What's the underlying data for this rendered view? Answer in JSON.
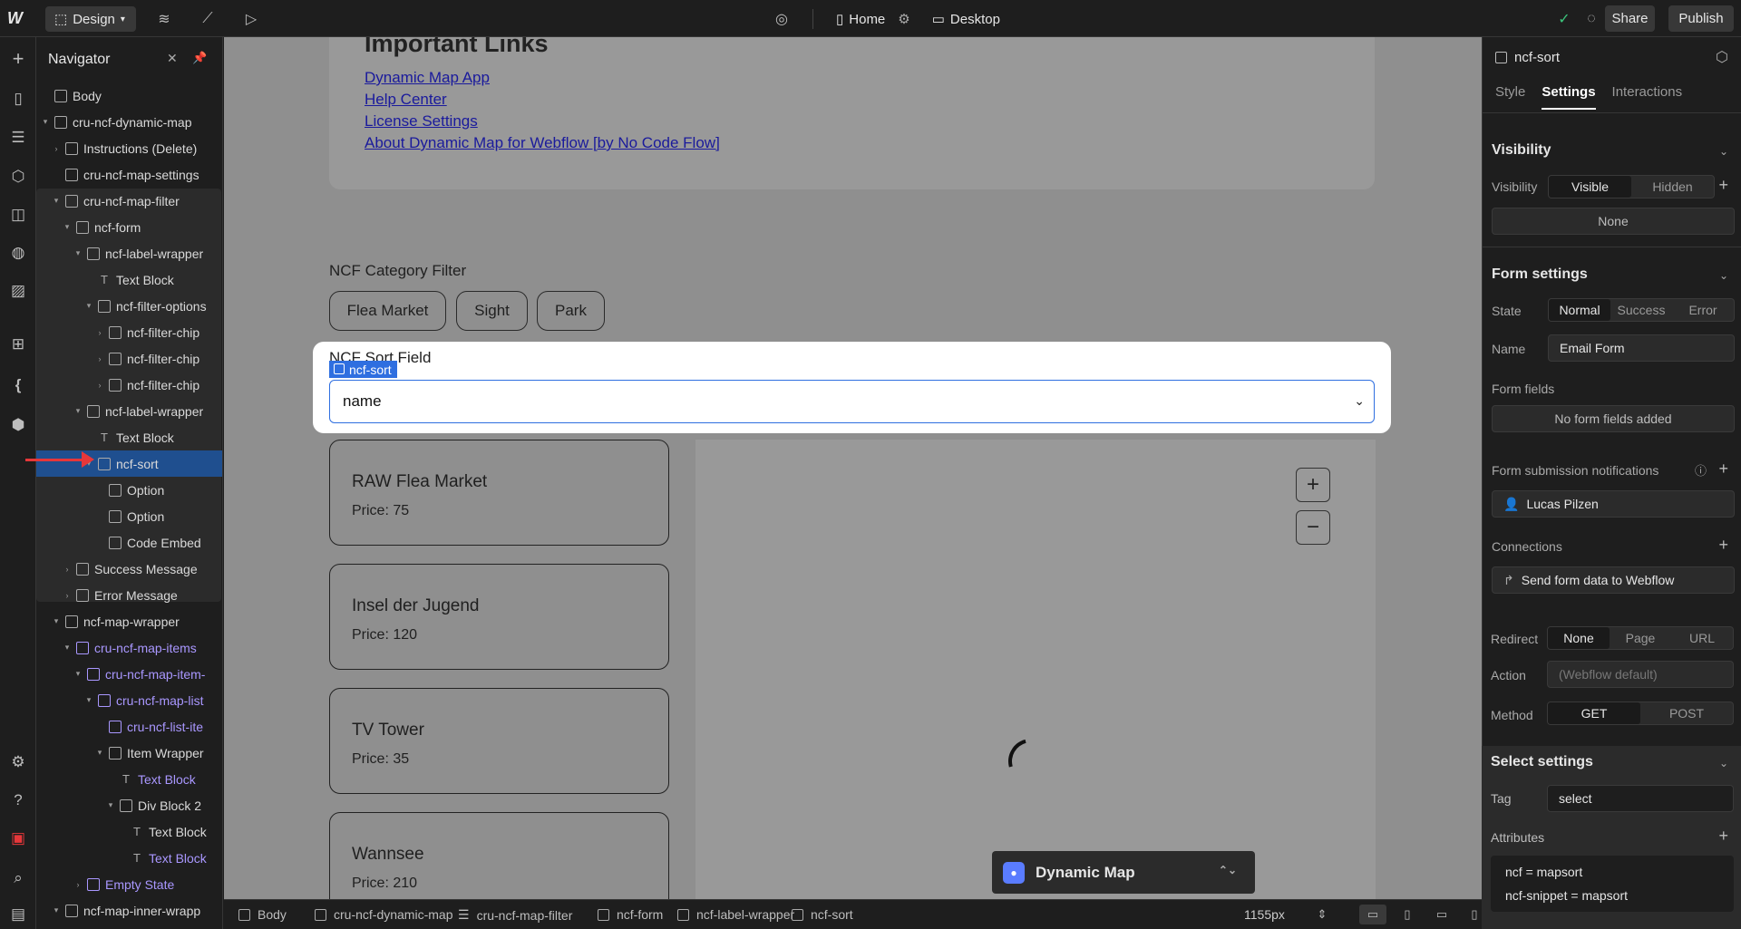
{
  "topbar": {
    "mode_label": "Design",
    "page_label": "Home",
    "device_label": "Desktop",
    "share_label": "Share",
    "publish_label": "Publish"
  },
  "navigator": {
    "title": "Navigator",
    "rows": [
      {
        "label": "Body",
        "indent": 0,
        "icon": "box-icon",
        "caret": ""
      },
      {
        "label": "cru-ncf-dynamic-map",
        "indent": 0,
        "icon": "box-icon",
        "caret": "▾"
      },
      {
        "label": "Instructions (Delete)",
        "indent": 1,
        "icon": "box-icon",
        "caret": "›"
      },
      {
        "label": "cru-ncf-map-settings",
        "indent": 1,
        "icon": "embed-icon",
        "caret": ""
      },
      {
        "label": "cru-ncf-map-filter",
        "indent": 1,
        "icon": "form-icon",
        "caret": "▾"
      },
      {
        "label": "ncf-form",
        "indent": 2,
        "icon": "box-icon",
        "caret": "▾"
      },
      {
        "label": "ncf-label-wrapper",
        "indent": 3,
        "icon": "box-icon",
        "caret": "▾"
      },
      {
        "label": "Text Block",
        "indent": 4,
        "icon": "text-icon",
        "caret": ""
      },
      {
        "label": "ncf-filter-options",
        "indent": 4,
        "icon": "box-icon",
        "caret": "▾"
      },
      {
        "label": "ncf-filter-chip",
        "indent": 5,
        "icon": "box-icon",
        "caret": "›"
      },
      {
        "label": "ncf-filter-chip",
        "indent": 5,
        "icon": "box-icon",
        "caret": "›"
      },
      {
        "label": "ncf-filter-chip",
        "indent": 5,
        "icon": "box-icon",
        "caret": "›"
      },
      {
        "label": "ncf-label-wrapper",
        "indent": 3,
        "icon": "box-icon",
        "caret": "▾"
      },
      {
        "label": "Text Block",
        "indent": 4,
        "icon": "text-icon",
        "caret": ""
      },
      {
        "label": "ncf-sort",
        "indent": 4,
        "icon": "select-icon",
        "caret": "▾",
        "selected": true
      },
      {
        "label": "Option",
        "indent": 5,
        "icon": "select-icon",
        "caret": ""
      },
      {
        "label": "Option",
        "indent": 5,
        "icon": "select-icon",
        "caret": ""
      },
      {
        "label": "Code Embed",
        "indent": 5,
        "icon": "embed-icon",
        "caret": ""
      },
      {
        "label": "Success Message",
        "indent": 2,
        "icon": "box-icon",
        "caret": "›"
      },
      {
        "label": "Error Message",
        "indent": 2,
        "icon": "box-icon",
        "caret": "›"
      },
      {
        "label": "ncf-map-wrapper",
        "indent": 1,
        "icon": "box-icon",
        "caret": "▾"
      },
      {
        "label": "cru-ncf-map-items",
        "indent": 2,
        "icon": "cms-icon",
        "caret": "▾",
        "purple": true
      },
      {
        "label": "cru-ncf-map-item-",
        "indent": 3,
        "icon": "cms-icon",
        "caret": "▾",
        "purple": true
      },
      {
        "label": "cru-ncf-map-list",
        "indent": 4,
        "icon": "cms-icon",
        "caret": "▾",
        "purple": true
      },
      {
        "label": "cru-ncf-list-ite",
        "indent": 5,
        "icon": "embed-icon",
        "caret": "",
        "purple": true
      },
      {
        "label": "Item Wrapper",
        "indent": 5,
        "icon": "box-icon",
        "caret": "▾"
      },
      {
        "label": "Text Block",
        "indent": 6,
        "icon": "text-icon",
        "caret": "",
        "purple": true
      },
      {
        "label": "Div Block 2",
        "indent": 6,
        "icon": "box-icon",
        "caret": "▾"
      },
      {
        "label": "Text Block",
        "indent": 7,
        "icon": "text-icon",
        "caret": ""
      },
      {
        "label": "Text Block",
        "indent": 7,
        "icon": "text-icon",
        "caret": "",
        "purple": true
      },
      {
        "label": "Empty State",
        "indent": 3,
        "icon": "cms-icon",
        "caret": "›",
        "purple": true
      },
      {
        "label": "ncf-map-inner-wrapp",
        "indent": 1,
        "icon": "box-icon",
        "caret": "▾"
      }
    ]
  },
  "canvas": {
    "links_title": "Important Links",
    "links": [
      "Dynamic Map App",
      "Help Center",
      "License Settings",
      "About Dynamic Map for Webflow [by No Code Flow]"
    ],
    "category_label": "NCF Category Filter",
    "chips": [
      "Flea Market",
      "Sight",
      "Park"
    ],
    "sort_label": "NCF Sort Field",
    "sort_tag": "ncf-sort",
    "sort_value": "name",
    "items": [
      {
        "title": "RAW Flea Market",
        "price": "Price: 75"
      },
      {
        "title": "Insel der Jugend",
        "price": "Price: 120"
      },
      {
        "title": "TV Tower",
        "price": "Price: 35"
      },
      {
        "title": "Wannsee",
        "price": "Price: 210"
      }
    ],
    "zoom_in": "+",
    "zoom_out": "−",
    "widget_label": "Dynamic Map"
  },
  "bottombar": {
    "crumbs": [
      "Body",
      "cru-ncf-dynamic-map",
      "cru-ncf-map-filter",
      "ncf-form",
      "ncf-label-wrapper",
      "ncf-sort"
    ],
    "width_label": "1155px"
  },
  "panel": {
    "element_name": "ncf-sort",
    "tabs": [
      "Style",
      "Settings",
      "Interactions"
    ],
    "visibility": {
      "title": "Visibility",
      "label": "Visibility",
      "options": [
        "Visible",
        "Hidden"
      ],
      "conditions": "None"
    },
    "form": {
      "title": "Form settings",
      "state_label": "State",
      "states": [
        "Normal",
        "Success",
        "Error"
      ],
      "name_label": "Name",
      "name_value": "Email Form",
      "fields_label": "Form fields",
      "fields_value": "No form fields added",
      "notif_label": "Form submission notifications",
      "notif_user": "Lucas Pilzen",
      "connections_label": "Connections",
      "connections_value": "Send form data to Webflow",
      "redirect_label": "Redirect",
      "redirect_options": [
        "None",
        "Page",
        "URL"
      ],
      "action_label": "Action",
      "action_placeholder": "(Webflow default)",
      "method_label": "Method",
      "methods": [
        "GET",
        "POST"
      ]
    },
    "select": {
      "title": "Select settings",
      "tag_label": "Tag",
      "tag_value": "select",
      "attributes_label": "Attributes",
      "attributes": [
        "ncf = mapsort",
        "ncf-snippet = mapsort"
      ]
    }
  },
  "colors": {
    "accent": "#2f6fe0",
    "selection": "#1f4f8f",
    "cms_purple": "#a997ff",
    "arrow_red": "#e6373a"
  }
}
